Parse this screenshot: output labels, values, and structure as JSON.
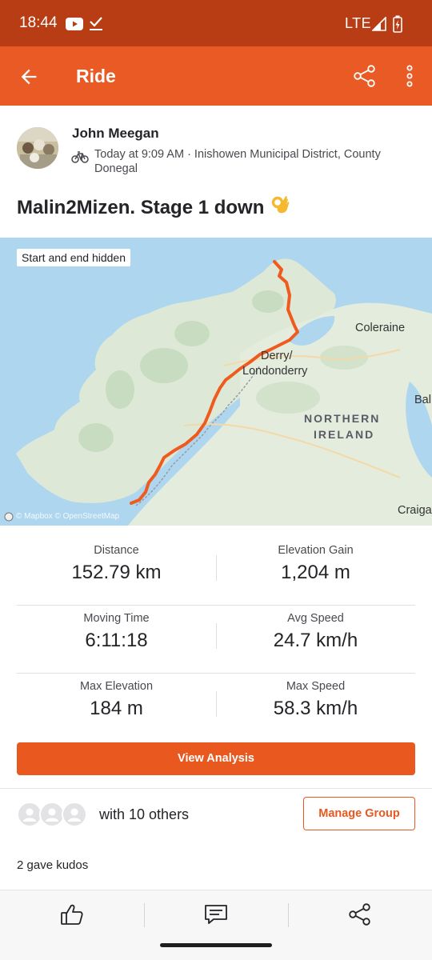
{
  "status_bar": {
    "time": "18:44",
    "network": "LTE"
  },
  "app_bar": {
    "title": "Ride"
  },
  "athlete": {
    "name": "John Meegan",
    "meta": "Today at 9:09 AM · Inishowen Municipal District, County Donegal"
  },
  "activity": {
    "title": "Malin2Mizen. Stage 1 down"
  },
  "map": {
    "privacy_badge": "Start and end hidden",
    "labels": {
      "coleraine": "Coleraine",
      "derry_1": "Derry/",
      "derry_2": "Londonderry",
      "ni_1": "NORTHERN",
      "ni_2": "IRELAND",
      "ball": "Ball",
      "craigav": "Craigav"
    },
    "attribution": "© Mapbox © OpenStreetMap"
  },
  "stats": [
    {
      "label": "Distance",
      "value": "152.79 km"
    },
    {
      "label": "Elevation Gain",
      "value": "1,204 m"
    },
    {
      "label": "Moving Time",
      "value": "6:11:18"
    },
    {
      "label": "Avg Speed",
      "value": "24.7 km/h"
    },
    {
      "label": "Max Elevation",
      "value": "184 m"
    },
    {
      "label": "Max Speed",
      "value": "58.3 km/h"
    }
  ],
  "actions": {
    "view_analysis": "View Analysis",
    "manage_group": "Manage Group"
  },
  "group": {
    "with_others": "with 10 others"
  },
  "kudos": {
    "text": "2 gave kudos"
  },
  "colors": {
    "brand": "#ea5a24",
    "status_bar": "#b93d14",
    "route": "#ef5a1f",
    "water": "#aed6ef"
  },
  "icons": {
    "back": "arrow-left-icon",
    "share": "share-icon",
    "more": "more-vertical-icon",
    "bike": "bike-icon",
    "kudos": "thumbs-up-icon",
    "comment": "comment-icon"
  }
}
